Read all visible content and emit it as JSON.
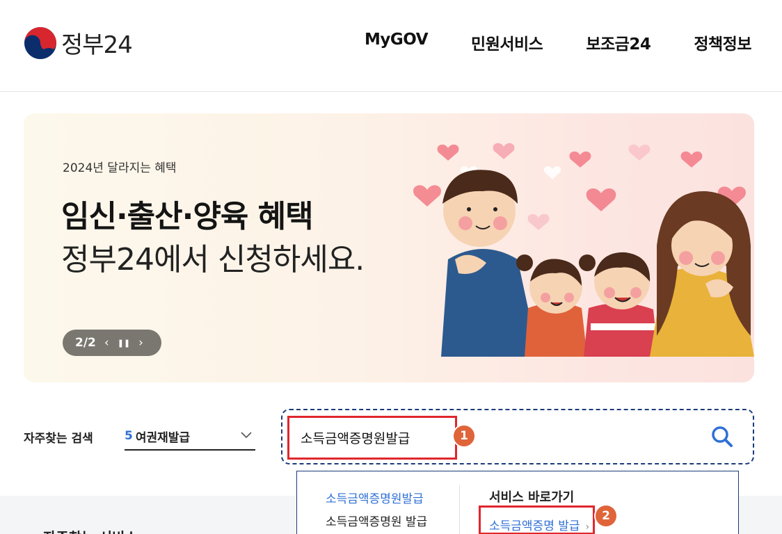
{
  "header": {
    "logo_text": "정부24",
    "nav": [
      "MyGOV",
      "민원서비스",
      "보조금24",
      "정책정보"
    ]
  },
  "banner": {
    "eyebrow": "2024년 달라지는 혜택",
    "title": "임신·출산·양육 혜택",
    "subtitle": "정부24에서 신청하세요.",
    "pager": "2/2",
    "prev_icon": "‹",
    "pause_icon": "❚❚",
    "next_icon": "›"
  },
  "search": {
    "faq_label": "자주찾는 검색",
    "faq_rank": "5",
    "faq_value": "여권재발급",
    "query": "소득금액증명원발급"
  },
  "autocomplete": {
    "suggestions": [
      "소득금액증명원발급",
      "소득금액증명원 발급"
    ],
    "shortcut_title": "서비스 바로가기",
    "shortcut_link": "소득금액증명 발급",
    "shortcut_arrow": "›"
  },
  "lower": {
    "title": "자주찾는 서비스"
  },
  "annotations": {
    "step1": "1",
    "step2": "2"
  },
  "colors": {
    "accent_blue": "#2f6fd6",
    "highlight_red": "#e0262c",
    "badge_orange": "#e0643a",
    "search_border": "#1a3a7a"
  }
}
